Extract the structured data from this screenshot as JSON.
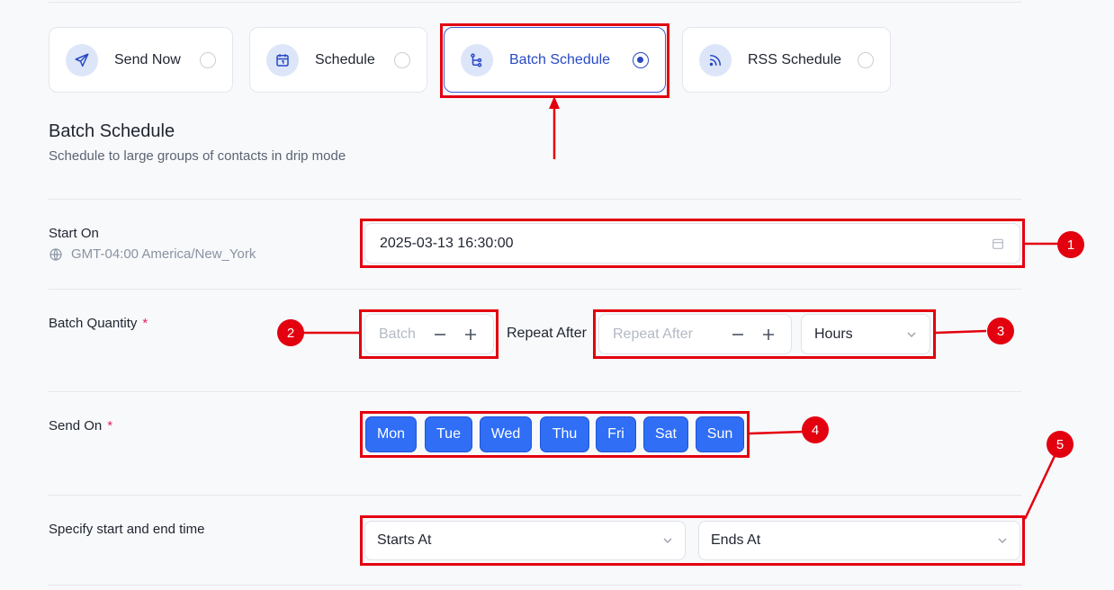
{
  "options": [
    {
      "label": "Send Now",
      "icon": "send-icon",
      "selected": false
    },
    {
      "label": "Schedule",
      "icon": "calendar-icon",
      "selected": false
    },
    {
      "label": "Batch Schedule",
      "icon": "branch-icon",
      "selected": true
    },
    {
      "label": "RSS Schedule",
      "icon": "rss-icon",
      "selected": false
    }
  ],
  "section": {
    "title": "Batch Schedule",
    "subtitle": "Schedule to large groups of contacts in drip mode"
  },
  "start_on": {
    "label": "Start On",
    "timezone": "GMT-04:00 America/New_York",
    "value": "2025-03-13 16:30:00"
  },
  "batch_quantity": {
    "label": "Batch Quantity",
    "required_mark": "*",
    "batch_placeholder": "Batch",
    "repeat_label": "Repeat After",
    "repeat_placeholder": "Repeat After",
    "unit_value": "Hours"
  },
  "send_on": {
    "label": "Send On",
    "required_mark": "*",
    "days": [
      "Mon",
      "Tue",
      "Wed",
      "Thu",
      "Fri",
      "Sat",
      "Sun"
    ]
  },
  "time_range": {
    "label": "Specify start and end time",
    "starts_placeholder": "Starts At",
    "ends_placeholder": "Ends At"
  },
  "annotations": [
    "1",
    "2",
    "3",
    "4",
    "5"
  ],
  "colors": {
    "accent": "#2849c4",
    "day_button": "#2f6ef5",
    "annotation_red": "#e3000f"
  }
}
